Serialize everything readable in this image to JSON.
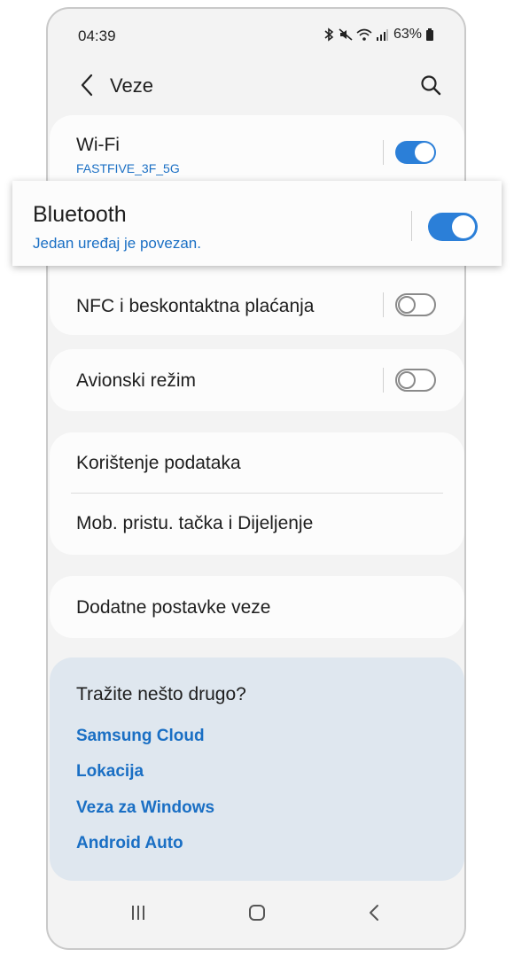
{
  "status_bar": {
    "time": "04:39",
    "battery": "63%",
    "icons": [
      "bluetooth-icon",
      "mute-icon",
      "wifi-icon",
      "signal-icon",
      "battery-icon"
    ]
  },
  "header": {
    "title": "Veze",
    "back_icon": "chevron-left-icon",
    "search_icon": "search-icon"
  },
  "connections": {
    "wifi": {
      "label": "Wi-Fi",
      "status": "FASTFIVE_3F_5G",
      "enabled": true
    },
    "bluetooth": {
      "label": "Bluetooth",
      "status": "Jedan uređaj je povezan.",
      "enabled": true
    },
    "nfc": {
      "label": "NFC i beskontaktna plaćanja",
      "enabled": false
    },
    "airplane": {
      "label": "Avionski režim",
      "enabled": false
    }
  },
  "data_section": {
    "data_usage": "Korištenje podataka",
    "hotspot": "Mob. pristu. tačka i Dijeljenje"
  },
  "more_section": {
    "more_settings": "Dodatne postavke veze"
  },
  "suggestions": {
    "title": "Tražite nešto drugo?",
    "links": [
      "Samsung Cloud",
      "Lokacija",
      "Veza za Windows",
      "Android Auto"
    ]
  },
  "nav": {
    "recents_icon": "recents-icon",
    "home_icon": "home-icon",
    "back_icon": "back-icon"
  },
  "colors": {
    "accent": "#2b7fd8",
    "link": "#1a6fc4",
    "background": "#f3f3f3",
    "card": "#fcfcfc",
    "suggestion_card": "#dfe7ef"
  }
}
